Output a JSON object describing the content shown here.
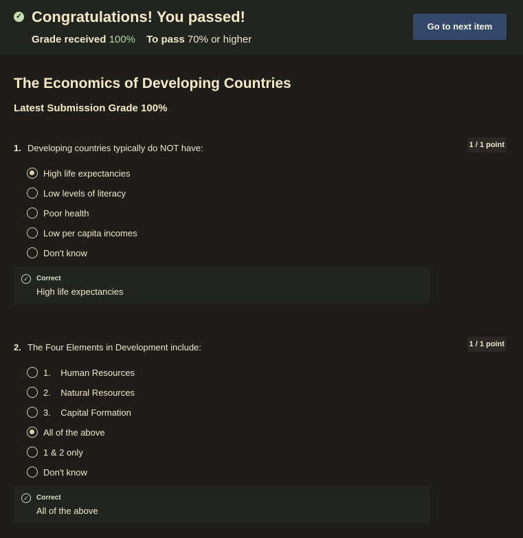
{
  "header": {
    "title": "Congratulations! You passed!",
    "grade_label": "Grade received",
    "grade_value": "100%",
    "pass_label": "To pass",
    "pass_value": "70% or higher",
    "next_button": "Go to next item"
  },
  "quiz": {
    "title": "The Economics of Developing Countries",
    "latest": "Latest Submission Grade 100%"
  },
  "questions": [
    {
      "number": "1.",
      "text": "Developing countries typically do NOT have:",
      "points": "1 / 1 point",
      "options": [
        "High life expectancies",
        "Low levels of literacy",
        "Poor health",
        "Low per capita incomes",
        "Don't know"
      ],
      "selected": 0,
      "feedback_label": "Correct",
      "feedback_text": "High life expectancies"
    },
    {
      "number": "2.",
      "text": "The Four Elements in Development include:",
      "points": "1 / 1 point",
      "options": [
        "1.    Human Resources",
        "2.    Natural Resources",
        "3.    Capital Formation",
        "All of the above",
        "1 & 2 only",
        "Don't know"
      ],
      "selected": 3,
      "feedback_label": "Correct",
      "feedback_text": "All of the above"
    }
  ],
  "colors": {
    "accent": "#34486a",
    "success": "#b7d6a8",
    "background": "#1e1d1a"
  }
}
